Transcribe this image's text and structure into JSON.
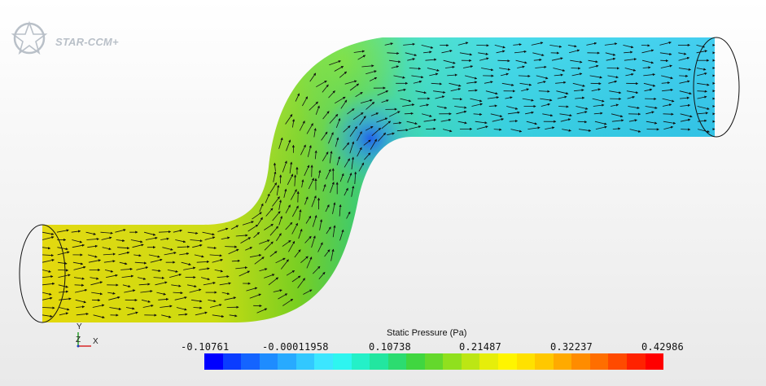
{
  "app": {
    "logo_text": "STAR-CCM+"
  },
  "axes_triad": {
    "y": "Y",
    "z": "Z",
    "x": "X"
  },
  "colorbar": {
    "title": "Static Pressure (Pa)",
    "labels": [
      "-0.10761",
      "-0.00011958",
      "0.10738",
      "0.21487",
      "0.32237",
      "0.42986"
    ],
    "colors": [
      "#0000ff",
      "#0a3cff",
      "#1464ff",
      "#1e8cff",
      "#28aaff",
      "#32c8ff",
      "#3ce6ff",
      "#2ef5f0",
      "#24f0c8",
      "#22e6a0",
      "#2cdc70",
      "#40d640",
      "#64d82c",
      "#90e01e",
      "#bce614",
      "#e6ee0a",
      "#fff500",
      "#ffe100",
      "#ffc800",
      "#ffaa00",
      "#ff8c00",
      "#ff6e00",
      "#ff4a00",
      "#ff2200",
      "#ff0000"
    ]
  }
}
